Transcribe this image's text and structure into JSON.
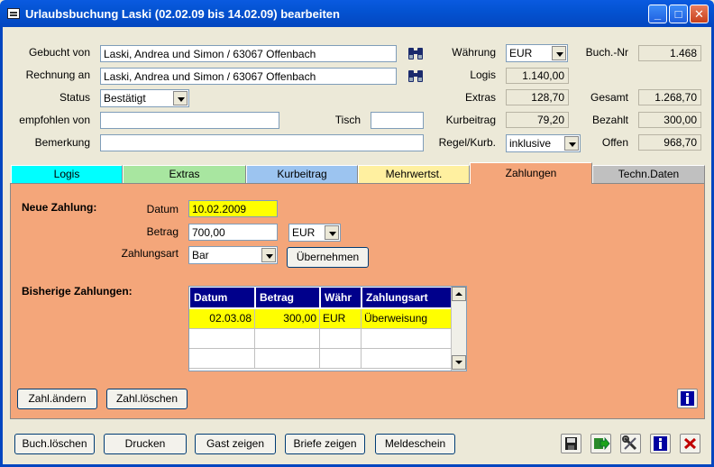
{
  "window": {
    "title": "Urlaubsbuchung Laski (02.02.09 bis 14.02.09) bearbeiten",
    "minimize": "_",
    "maximize": "□",
    "close": "✕"
  },
  "form": {
    "gebucht_von_label": "Gebucht von",
    "gebucht_von": "Laski, Andrea und Simon / 63067 Offenbach",
    "rechnung_an_label": "Rechnung an",
    "rechnung_an": "Laski, Andrea und Simon / 63067 Offenbach",
    "status_label": "Status",
    "status": "Bestätigt",
    "empfohlen_von_label": "empfohlen von",
    "empfohlen_von": "",
    "tisch_label": "Tisch",
    "tisch": "",
    "bemerkung_label": "Bemerkung",
    "bemerkung": ""
  },
  "totals": {
    "waehrung_label": "Währung",
    "waehrung": "EUR",
    "logis_label": "Logis",
    "logis": "1.140,00",
    "extras_label": "Extras",
    "extras": "128,70",
    "kurbeitrag_label": "Kurbeitrag",
    "kurbeitrag": "79,20",
    "regel_label": "Regel/Kurb.",
    "regel": "inklusive",
    "buchnr_label": "Buch.-Nr",
    "buchnr": "1.468",
    "gesamt_label": "Gesamt",
    "gesamt": "1.268,70",
    "bezahlt_label": "Bezahlt",
    "bezahlt": "300,00",
    "offen_label": "Offen",
    "offen": "968,70"
  },
  "tabs": [
    {
      "label": "Logis",
      "color": "#00ffff"
    },
    {
      "label": "Extras",
      "color": "#a8e6a0"
    },
    {
      "label": "Kurbeitrag",
      "color": "#9cc4f0"
    },
    {
      "label": "Mehrwertst.",
      "color": "#fff0a0"
    },
    {
      "label": "Zahlungen",
      "color": "#f4a67a"
    },
    {
      "label": "Techn.Daten",
      "color": "#c0c0c0"
    }
  ],
  "payment": {
    "heading": "Neue Zahlung:",
    "datum_label": "Datum",
    "datum": "10.02.2009",
    "betrag_label": "Betrag",
    "betrag": "700,00",
    "waehrung": "EUR",
    "zahlungsart_label": "Zahlungsart",
    "zahlungsart": "Bar",
    "uebernehmen": "Übernehmen"
  },
  "history": {
    "heading": "Bisherige Zahlungen:",
    "columns": [
      "Datum",
      "Betrag",
      "Währ",
      "Zahlungsart"
    ],
    "rows": [
      {
        "datum": "02.03.08",
        "betrag": "300,00",
        "waehr": "EUR",
        "art": "Überweisung"
      }
    ]
  },
  "panel_buttons": {
    "aendern": "Zahl.ändern",
    "loeschen": "Zahl.löschen"
  },
  "bottom_buttons": {
    "buch_loeschen": "Buch.löschen",
    "drucken": "Drucken",
    "gast_zeigen": "Gast zeigen",
    "briefe_zeigen": "Briefe zeigen",
    "meldeschein": "Meldeschein"
  },
  "colors": {
    "title_bar": "#0453d2",
    "panel": "#f4a67a",
    "highlight": "#ffff00",
    "grid_header": "#00008b"
  },
  "icons": [
    "app-icon",
    "binoculars-icon",
    "info-icon",
    "save-icon",
    "export-icon",
    "tools-icon",
    "close-x-icon"
  ]
}
